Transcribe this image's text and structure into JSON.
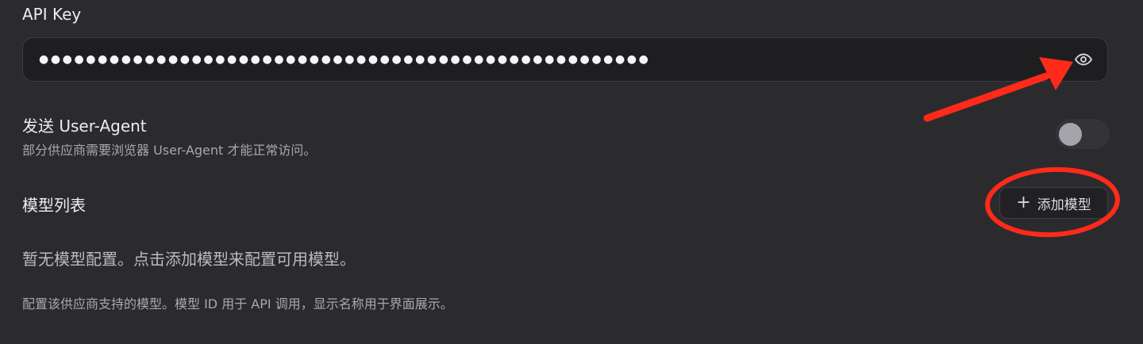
{
  "api_key": {
    "label": "API Key",
    "masked_value": "●●●●●●●●●●●●●●●●●●●●●●●●●●●●●●●●●●●●●●●●●●●●●●●●●●●●",
    "icon": "eye-icon"
  },
  "user_agent": {
    "title": "发送 User-Agent",
    "description": "部分供应商需要浏览器 User-Agent 才能正常访问。",
    "enabled": false
  },
  "models": {
    "title": "模型列表",
    "add_button_icon": "plus-icon",
    "add_button_label": "添加模型",
    "empty_text": "暂无模型配置。点击添加模型来配置可用模型。",
    "help_text": "配置该供应商支持的模型。模型 ID 用于 API 调用，显示名称用于界面展示。"
  },
  "annotation": {
    "color": "#ff2a1a"
  }
}
